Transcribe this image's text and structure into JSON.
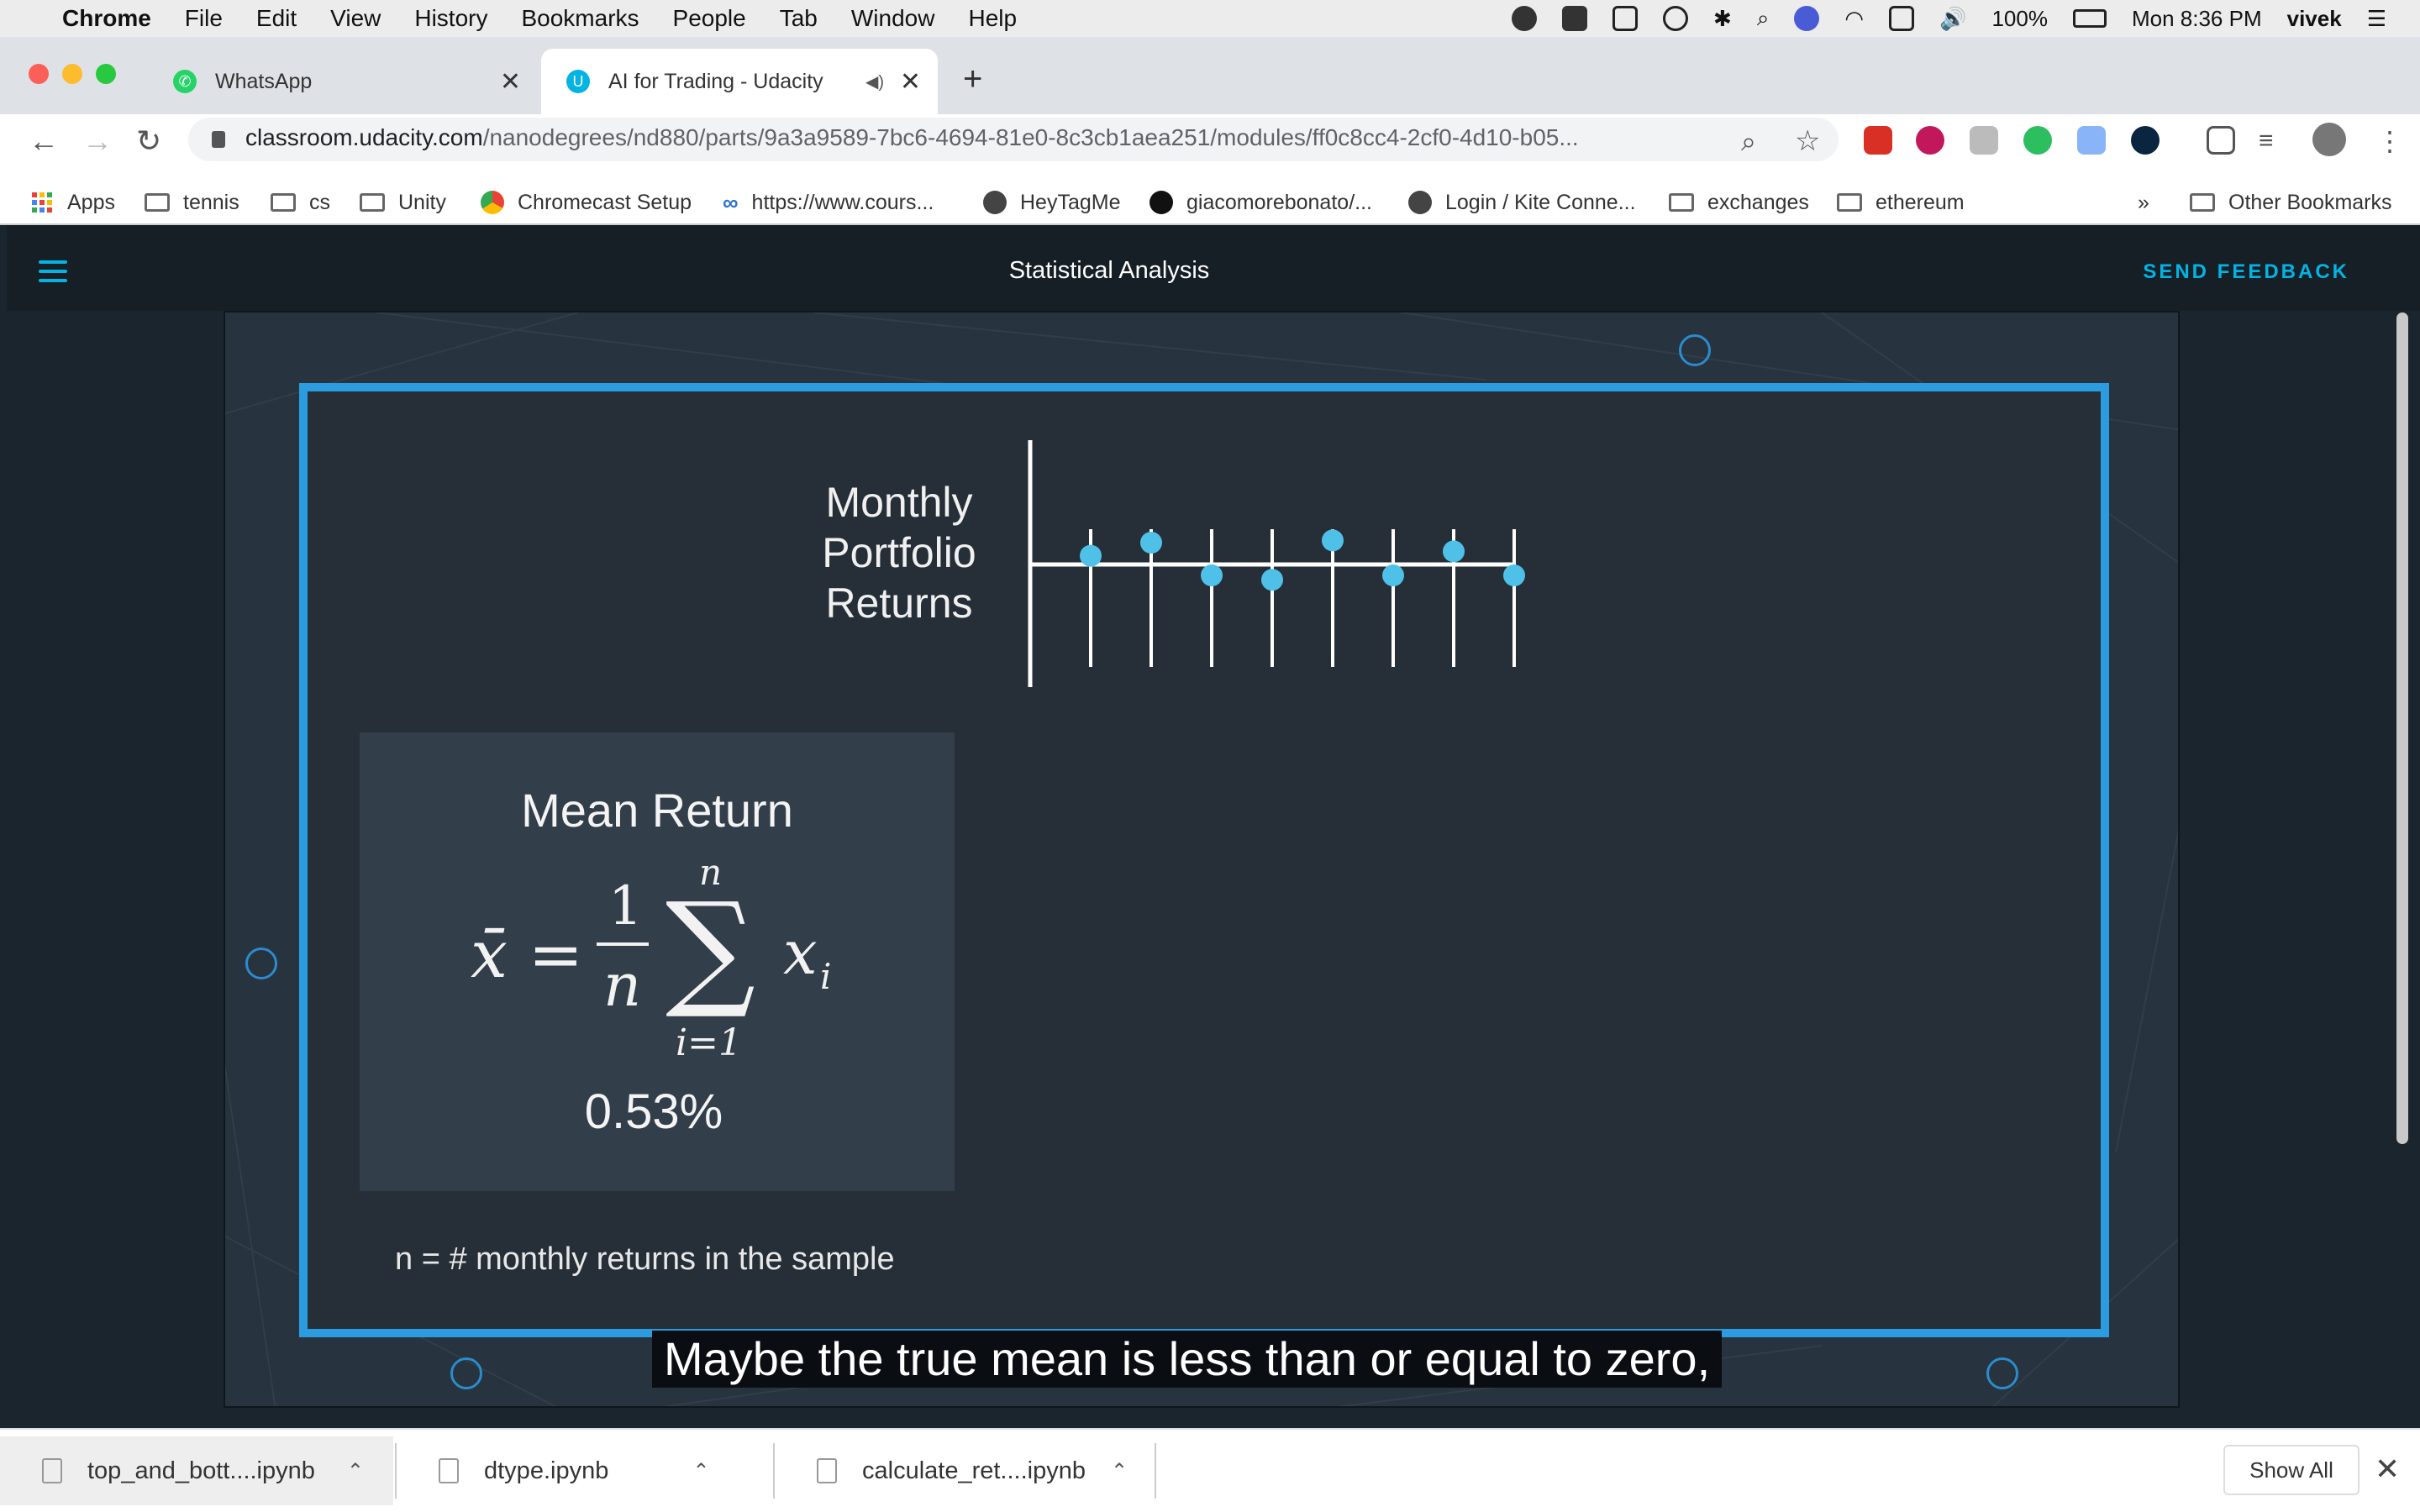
{
  "menubar": {
    "items": [
      "Chrome",
      "File",
      "Edit",
      "View",
      "History",
      "Bookmarks",
      "People",
      "Tab",
      "Window",
      "Help"
    ],
    "battery": "100%",
    "clock": "Mon 8:36 PM",
    "user": "vivek"
  },
  "tabs": [
    {
      "title": "WhatsApp",
      "icon": "whatsapp-icon",
      "active": false
    },
    {
      "title": "AI for Trading - Udacity",
      "icon": "udacity-icon",
      "active": true
    }
  ],
  "omnibox": {
    "host": "classroom.udacity.com",
    "path": "/nanodegrees/nd880/parts/9a3a9589-7bc6-4694-81e0-8c3cb1aea251/modules/ff0c8cc4-2cf0-4d10-b05..."
  },
  "bookmarks": {
    "items": [
      "Apps",
      "tennis",
      "cs",
      "Unity",
      "Chromecast Setup",
      "https://www.cours...",
      "HeyTagMe",
      "giacomorebonato/...",
      "Login / Kite Conne...",
      "exchanges",
      "ethereum"
    ],
    "overflow": "»",
    "other": "Other Bookmarks"
  },
  "header": {
    "title": "Statistical Analysis",
    "feedback": "SEND FEEDBACK"
  },
  "video": {
    "chart_title_lines": [
      "Monthly",
      "Portfolio",
      "Returns"
    ],
    "mean_label": "Mean Return",
    "formula": {
      "lhs": "x̄ =",
      "numerator": "1",
      "denominator": "n",
      "upper": "n",
      "lower": "i=1",
      "term": "x",
      "subscript": "i"
    },
    "mean_value": "0.53%",
    "note": "n = # monthly returns in the sample",
    "caption": "Maybe the true mean is less than or equal to zero,"
  },
  "chart_data": {
    "type": "scatter",
    "title": "Monthly Portfolio Returns",
    "x": [
      1,
      2,
      3,
      4,
      5,
      6,
      7,
      8
    ],
    "values": [
      0.4,
      1.0,
      -0.5,
      -0.7,
      1.1,
      -0.5,
      0.6,
      -0.5
    ],
    "ylim": [
      -2.8,
      2.8
    ],
    "grid": false,
    "legend": "none"
  },
  "downloads": [
    {
      "name": "top_and_bott....ipynb"
    },
    {
      "name": "dtype.ipynb"
    },
    {
      "name": "calculate_ret....ipynb"
    }
  ],
  "downloads_show_all": "Show All",
  "colors": {
    "accent": "#02b3e4",
    "frame": "#2b9ce0",
    "marker": "#4fc1e9"
  }
}
